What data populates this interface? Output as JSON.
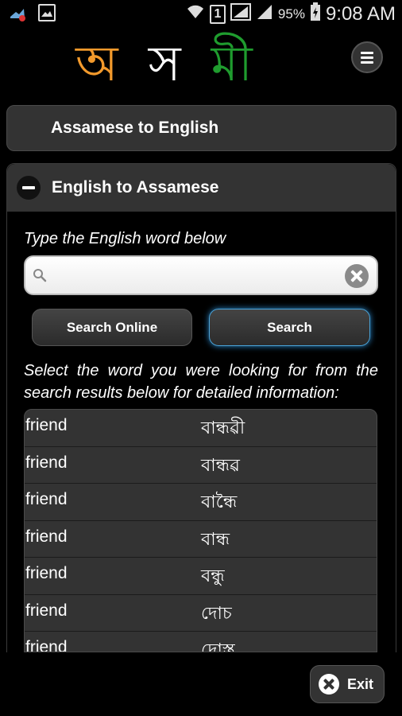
{
  "status_bar": {
    "sim_label": "1",
    "battery": "95%",
    "time": "9:08 AM"
  },
  "header": {
    "logo": [
      "অ",
      "স",
      "মী"
    ],
    "logo_colors": [
      "#f39a2c",
      "#ffffff",
      "#1f9c2e"
    ],
    "menu_icon": "hamburger-menu-icon"
  },
  "panels": {
    "assamese_to_english": "Assamese to English",
    "english_to_assamese": "English to Assamese"
  },
  "search": {
    "prompt": "Type the English word below",
    "value": "",
    "placeholder": "",
    "online_button": "Search Online",
    "search_button": "Search"
  },
  "instructions": "Select the word you were looking for from the search results below for detailed information:",
  "results": [
    {
      "en": "friend",
      "as": "বান্ধৱী"
    },
    {
      "en": "friend",
      "as": "বান্ধৱ"
    },
    {
      "en": "friend",
      "as": "বান্ধৈ"
    },
    {
      "en": "friend",
      "as": "বান্ধ"
    },
    {
      "en": "friend",
      "as": "বন্ধু"
    },
    {
      "en": "friend",
      "as": "দোচ"
    },
    {
      "en": "friend",
      "as": "দোস্ত"
    }
  ],
  "exit_button": "Exit",
  "colors": {
    "background": "#000000",
    "panel": "#333333",
    "accent_glow": "#2a86c8"
  }
}
